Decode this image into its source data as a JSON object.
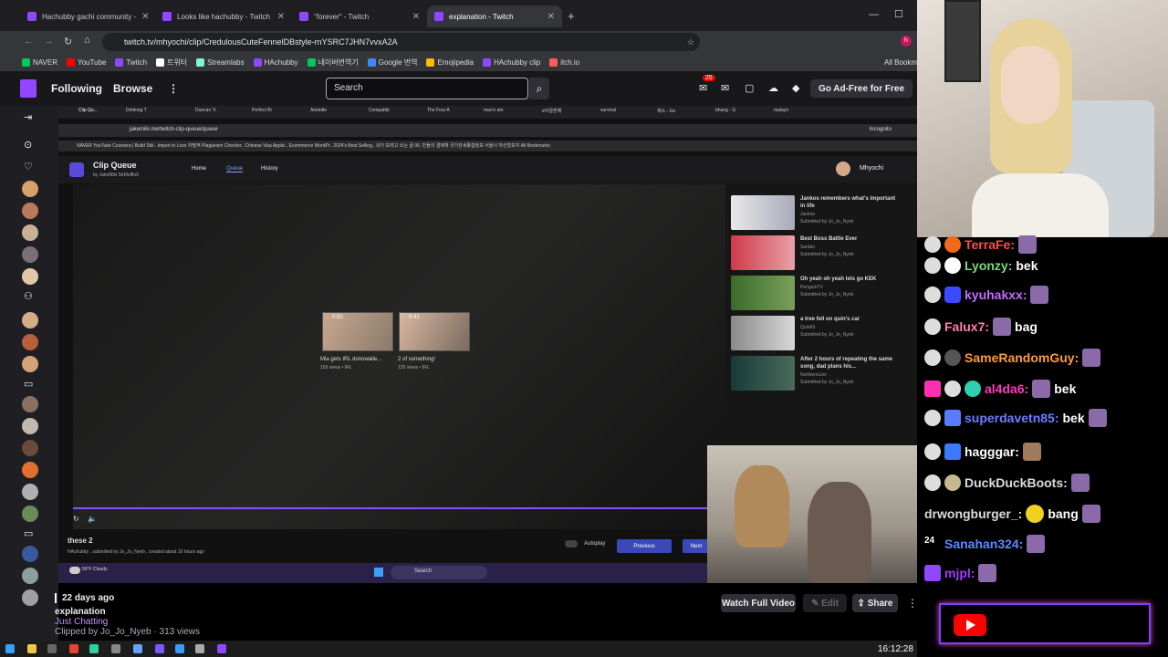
{
  "browser": {
    "tabs": [
      {
        "title": "Hachubby gachi community - ",
        "active": false
      },
      {
        "title": "Looks like hachubby - Twitch",
        "active": false
      },
      {
        "title": "\"forever\" - Twitch",
        "active": false
      },
      {
        "title": "explanation - Twitch",
        "active": true
      }
    ],
    "url": "twitch.tv/mhyochi/clip/CredulousCuteFennelDBstyle-rnYSRC7JHN7vvxA2A",
    "bookmarks": [
      "NAVER",
      "YouTube",
      "Twitch",
      "트위터",
      "Streamlabs",
      "HAchubby",
      "네이버번역기",
      "Google 번역",
      "Emojipedia",
      "HAchubby clip",
      "itch.io"
    ],
    "all_bookmarks": "All Bookm"
  },
  "twitch": {
    "following": "Following",
    "browse": "Browse",
    "search_placeholder": "Search",
    "notif_count": "25",
    "ad_free": "Go Ad-Free for Free"
  },
  "inner": {
    "tabs": [
      "Clip Qu...",
      "Drinking T",
      "Duncan Tr",
      "Perfect Bi",
      "Aristotle",
      "Compatibi",
      "The Four A",
      "mao's am",
      "e야결혼해",
      "survival",
      "재소 - Go",
      "bhang - G",
      "malayo"
    ],
    "url": "jakemiki.me/twitch-clip-queue/queue",
    "incognito": "Incognito",
    "bookmarks": "NAVER  YouTube  Coursera | Build Skil..  Import to Loox  자필켜  Plagiarism Checker..  Chinese Visa Applic..  Ecommerce WordPr..  2024's Best Selling..  내가 보려고 쓰는 글  06. 민들의 결제책  국가관세종합정보  서울시 자산형보지  All Bookmarks",
    "app_title": "Clip Queue",
    "app_by": "by  JakeMiki  SirMuffin9",
    "nav": [
      "Home",
      "Queue",
      "History"
    ],
    "user": "Mhyochi",
    "cards": [
      {
        "duration": "0:50",
        "title": "Mia gets IRL donowalle...",
        "meta": "159 views • IRL"
      },
      {
        "duration": "0:41",
        "title": "2 of something!",
        "meta": "125 views • IRL"
      }
    ],
    "queue": [
      {
        "title": "Jankos remembers what's important in life",
        "channel": "Jankos",
        "by": "Submitted by Jo_Jo_Nyeb"
      },
      {
        "title": "Best Boss Battle Ever",
        "channel": "Sardan",
        "by": "Submitted by Jo_Jo_Nyeb"
      },
      {
        "title": "Oh yeah oh yeah lets go KEK",
        "channel": "PenguinTV",
        "by": "Submitted by Jo_Jo_Nyeb"
      },
      {
        "title": "a tree fell on quin's car",
        "channel": "Quin69",
        "by": "Submitted by Jo_Jo_Nyeb"
      },
      {
        "title": "After 2 hours of repeating the same song, dad plans his...",
        "channel": "NorthernLion",
        "by": "Submitted by Jo_Jo_Nyeb"
      }
    ],
    "clip_title": "these 2",
    "clip_by": "HAchubby , submitted by Jo_Jo_Nyeb , created about 16 hours ago",
    "autoplay": "Autoplay",
    "previous": "Previous",
    "next": "Next",
    "weather": "59°F Cloudy",
    "taskbar_search": "Search"
  },
  "clip_info": {
    "age": "22 days ago",
    "title": "explanation",
    "category": "Just Chatting",
    "clipped_by": "Clipped by Jo_Jo_Nyeb · 313 views",
    "watch_full": "Watch Full Video",
    "edit": "Edit",
    "share": "Share"
  },
  "chat": [
    {
      "user": "TerraFe:",
      "color": "#ff4b4b",
      "text": ""
    },
    {
      "user": "Lyonzy:",
      "color": "#7dd87d",
      "text": "bek"
    },
    {
      "user": "kyuhakxx:",
      "color": "#c46bff",
      "text": ""
    },
    {
      "user": "Falux7:",
      "color": "#ff7fa8",
      "text": "bag"
    },
    {
      "user": "SameRandomGuy:",
      "color": "#ff9a3c",
      "text": ""
    },
    {
      "user": "al4da6:",
      "color": "#ff3bbf",
      "text": "bek"
    },
    {
      "user": "superdavetn85:",
      "color": "#6b7dff",
      "text": "bek"
    },
    {
      "user": "hagggar:",
      "color": "#ffffff",
      "text": ""
    },
    {
      "user": "DuckDuckBoots:",
      "color": "#dcdcdc",
      "text": ""
    },
    {
      "user": "drwongburger_:",
      "color": "#dcdcdc",
      "text": "bang"
    },
    {
      "user": "Sanahan324:",
      "color": "#5a8aff",
      "text": ""
    },
    {
      "user": "mjpl:",
      "color": "#a23bff",
      "text": ""
    }
  ],
  "clock": "16:12:28"
}
